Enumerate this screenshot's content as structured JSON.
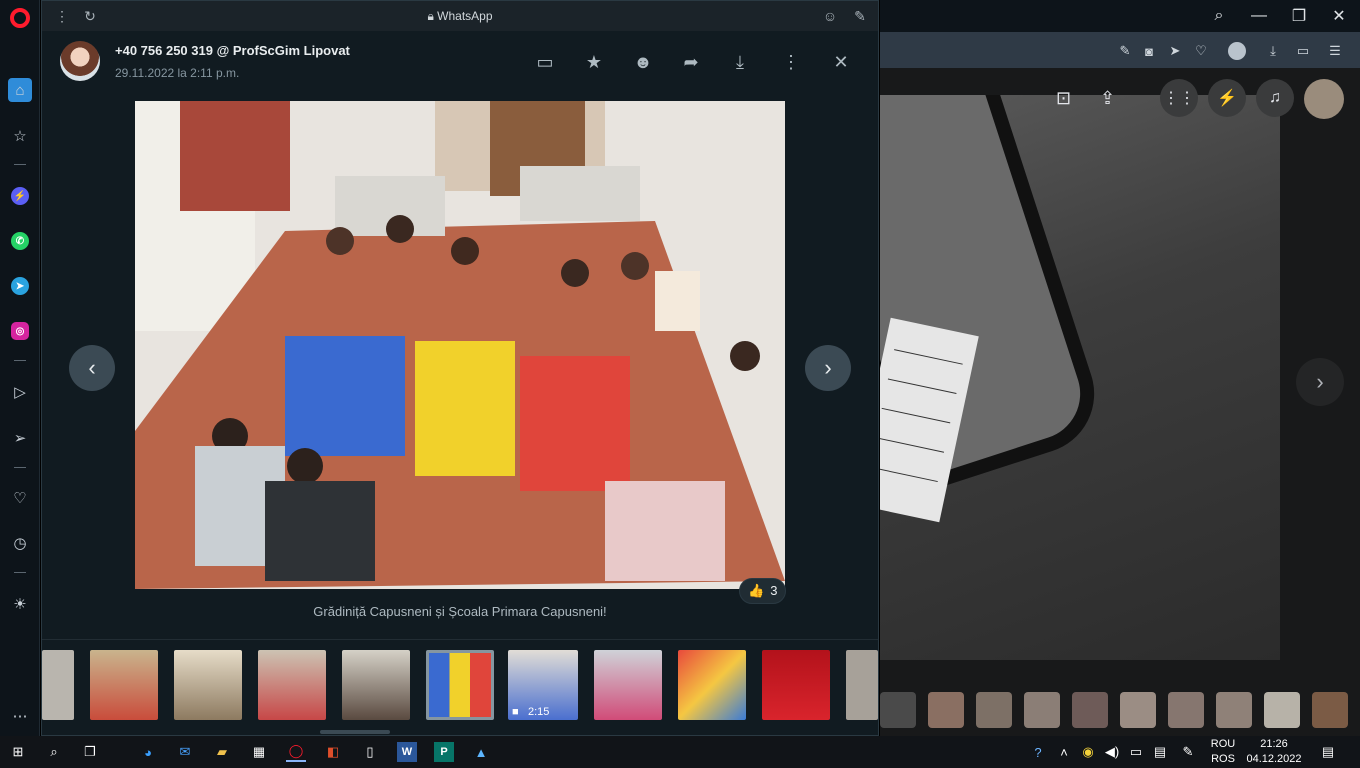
{
  "whatsapp": {
    "window_title": "WhatsApp",
    "sender": "+40 756 250 319 @ ProfScGim Lipovat",
    "date": "29.11.2022 la 2:11 p.m.",
    "caption": "Grădiniță Capusneni și Școala Primara Capusneni!",
    "reaction": {
      "emoji": "👍",
      "count": "3"
    },
    "header_icons": [
      "chat-icon",
      "star-icon",
      "emoji-icon",
      "forward-icon",
      "download-icon",
      "more-icon",
      "close-icon"
    ],
    "thumbnails": [
      {
        "name": "thumb-1"
      },
      {
        "name": "thumb-2"
      },
      {
        "name": "thumb-3"
      },
      {
        "name": "thumb-4"
      },
      {
        "name": "thumb-5"
      },
      {
        "name": "thumb-6-selected"
      },
      {
        "name": "thumb-7-video",
        "duration": "2:15"
      },
      {
        "name": "thumb-8"
      },
      {
        "name": "thumb-9"
      },
      {
        "name": "thumb-10"
      },
      {
        "name": "thumb-11"
      }
    ]
  },
  "taskbar": {
    "language": "ROU",
    "keyboard": "ROS",
    "time": "21:26",
    "date": "04.12.2022"
  },
  "colors": {
    "wa_background": "#111b21",
    "wa_panel": "#1b2329",
    "opera_red": "#ff1b2d",
    "taskbar": "#111418"
  }
}
